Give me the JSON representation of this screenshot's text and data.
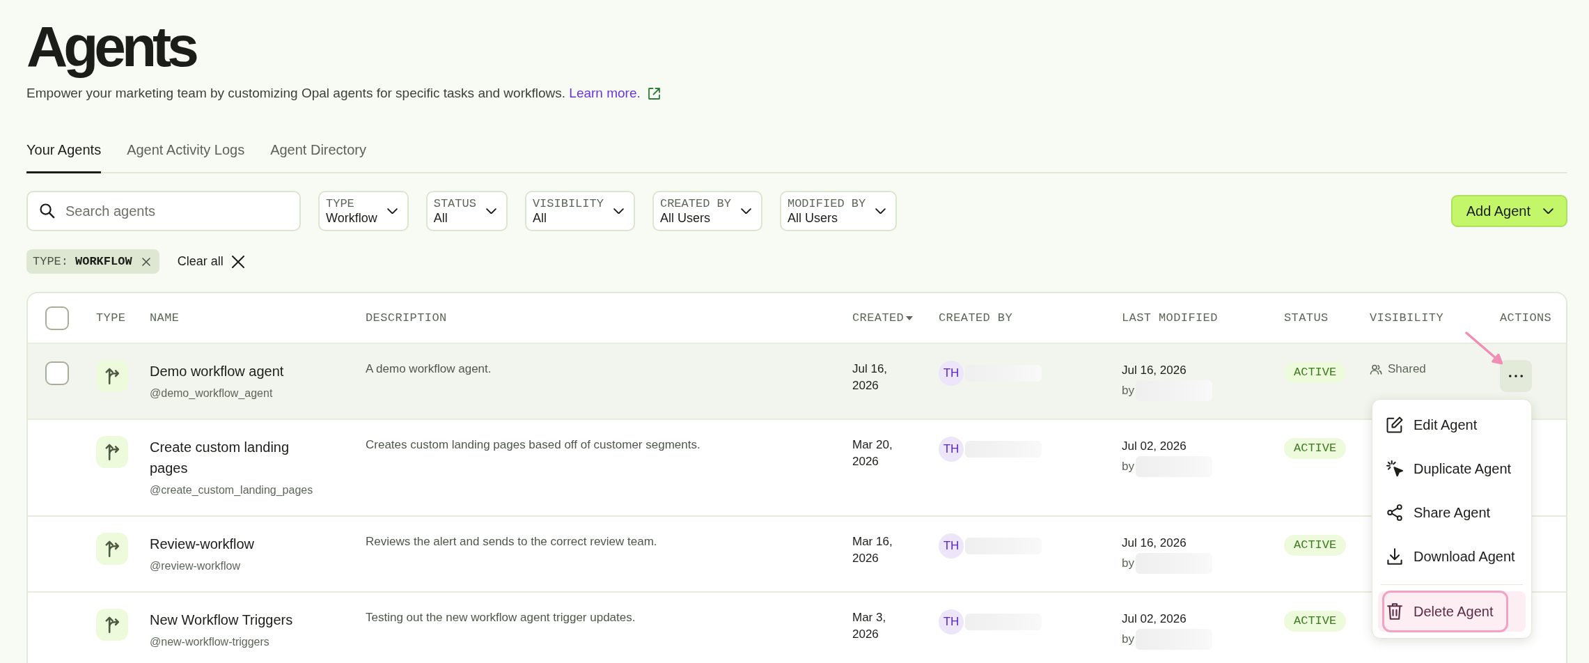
{
  "page": {
    "title": "Agents",
    "description": "Empower your marketing team by customizing Opal agents for specific tasks and workflows.",
    "link": "Learn more."
  },
  "tabs": [
    {
      "label": "Your Agents",
      "selected": true
    },
    {
      "label": "Agent Activity Logs",
      "selected": false
    },
    {
      "label": "Agent Directory",
      "selected": false
    }
  ],
  "search": {
    "placeholder": "Search agents"
  },
  "filters": [
    {
      "label": "TYPE",
      "value": "Workflow"
    },
    {
      "label": "STATUS",
      "value": "All"
    },
    {
      "label": "VISIBILITY",
      "value": "All"
    },
    {
      "label": "CREATED BY",
      "value": "All Users"
    },
    {
      "label": "MODIFIED BY",
      "value": "All Users"
    }
  ],
  "add_button": {
    "label": "Add Agent"
  },
  "active_filters": [
    {
      "label": "TYPE:",
      "value": "WORKFLOW"
    }
  ],
  "clear_all": {
    "label": "Clear all"
  },
  "table": {
    "select_all": {
      "checked": false
    },
    "columns": [
      {
        "label": "TYPE",
        "sorted": false
      },
      {
        "label": "NAME",
        "sorted": false
      },
      {
        "label": "DESCRIPTION",
        "sorted": false
      },
      {
        "label": "CREATED",
        "sorted": true
      },
      {
        "label": "CREATED BY",
        "sorted": false
      },
      {
        "label": "LAST MODIFIED",
        "sorted": false
      },
      {
        "label": "STATUS",
        "sorted": false
      },
      {
        "label": "VISIBILITY",
        "sorted": false
      },
      {
        "label": "ACTIONS",
        "sorted": false
      }
    ],
    "rows": [
      {
        "kind": "workflow",
        "highlighted": true,
        "checked": false,
        "menu_open": true,
        "name": "Demo workflow agent",
        "handle": "@demo_workflow_agent",
        "description": "A demo workflow agent.",
        "created": "Jul 16, 2026",
        "created_by": {
          "initials": "TH",
          "name_blurred": true
        },
        "last_modified": "Jul 16, 2026",
        "modified_by": {
          "prefix": "by",
          "name_blurred": true
        },
        "status": "ACTIVE",
        "visibility": "Shared"
      },
      {
        "kind": "workflow",
        "highlighted": false,
        "checked": false,
        "menu_open": false,
        "name": "Create custom landing pages",
        "handle": "@create_custom_landing_pages",
        "description": "Creates custom landing pages based off of customer segments.",
        "created": "Mar 20, 2026",
        "created_by": {
          "initials": "TH",
          "name_blurred": true
        },
        "last_modified": "Jul 02, 2026",
        "modified_by": {
          "prefix": "by",
          "name_blurred": true
        },
        "status": "ACTIVE"
      },
      {
        "kind": "workflow",
        "highlighted": false,
        "checked": false,
        "menu_open": false,
        "name": "Review-workflow",
        "handle": "@review-workflow",
        "description": "Reviews the alert and sends to the correct review team.",
        "created": "Mar 16, 2026",
        "created_by": {
          "initials": "TH",
          "name_blurred": true
        },
        "last_modified": "Jul 16, 2026",
        "modified_by": {
          "prefix": "by",
          "name_blurred": true
        },
        "status": "ACTIVE"
      },
      {
        "kind": "workflow",
        "highlighted": false,
        "checked": false,
        "menu_open": false,
        "name": "New Workflow Triggers",
        "handle": "@new-workflow-triggers",
        "description": "Testing out the new workflow agent trigger updates.",
        "created": "Mar 3, 2026",
        "created_by": {
          "initials": "TH",
          "name_blurred": true
        },
        "last_modified": "Jul 02, 2026",
        "modified_by": {
          "prefix": "by",
          "name_blurred": true
        },
        "status": "ACTIVE"
      }
    ],
    "row_menu": {
      "groups": [
        {
          "items": [
            {
              "kind": "edit",
              "label": "Edit Agent",
              "highlighted": false,
              "annotated": false
            },
            {
              "kind": "duplicate",
              "label": "Duplicate Agent",
              "highlighted": false,
              "annotated": false
            },
            {
              "kind": "share",
              "label": "Share Agent",
              "highlighted": false,
              "annotated": false
            },
            {
              "kind": "download",
              "label": "Download Agent",
              "highlighted": false,
              "annotated": false
            }
          ]
        },
        {
          "items": [
            {
              "kind": "delete",
              "label": "Delete Agent",
              "highlighted": true,
              "annotated": true
            }
          ]
        }
      ]
    }
  },
  "annotation": {
    "arrow": true
  }
}
